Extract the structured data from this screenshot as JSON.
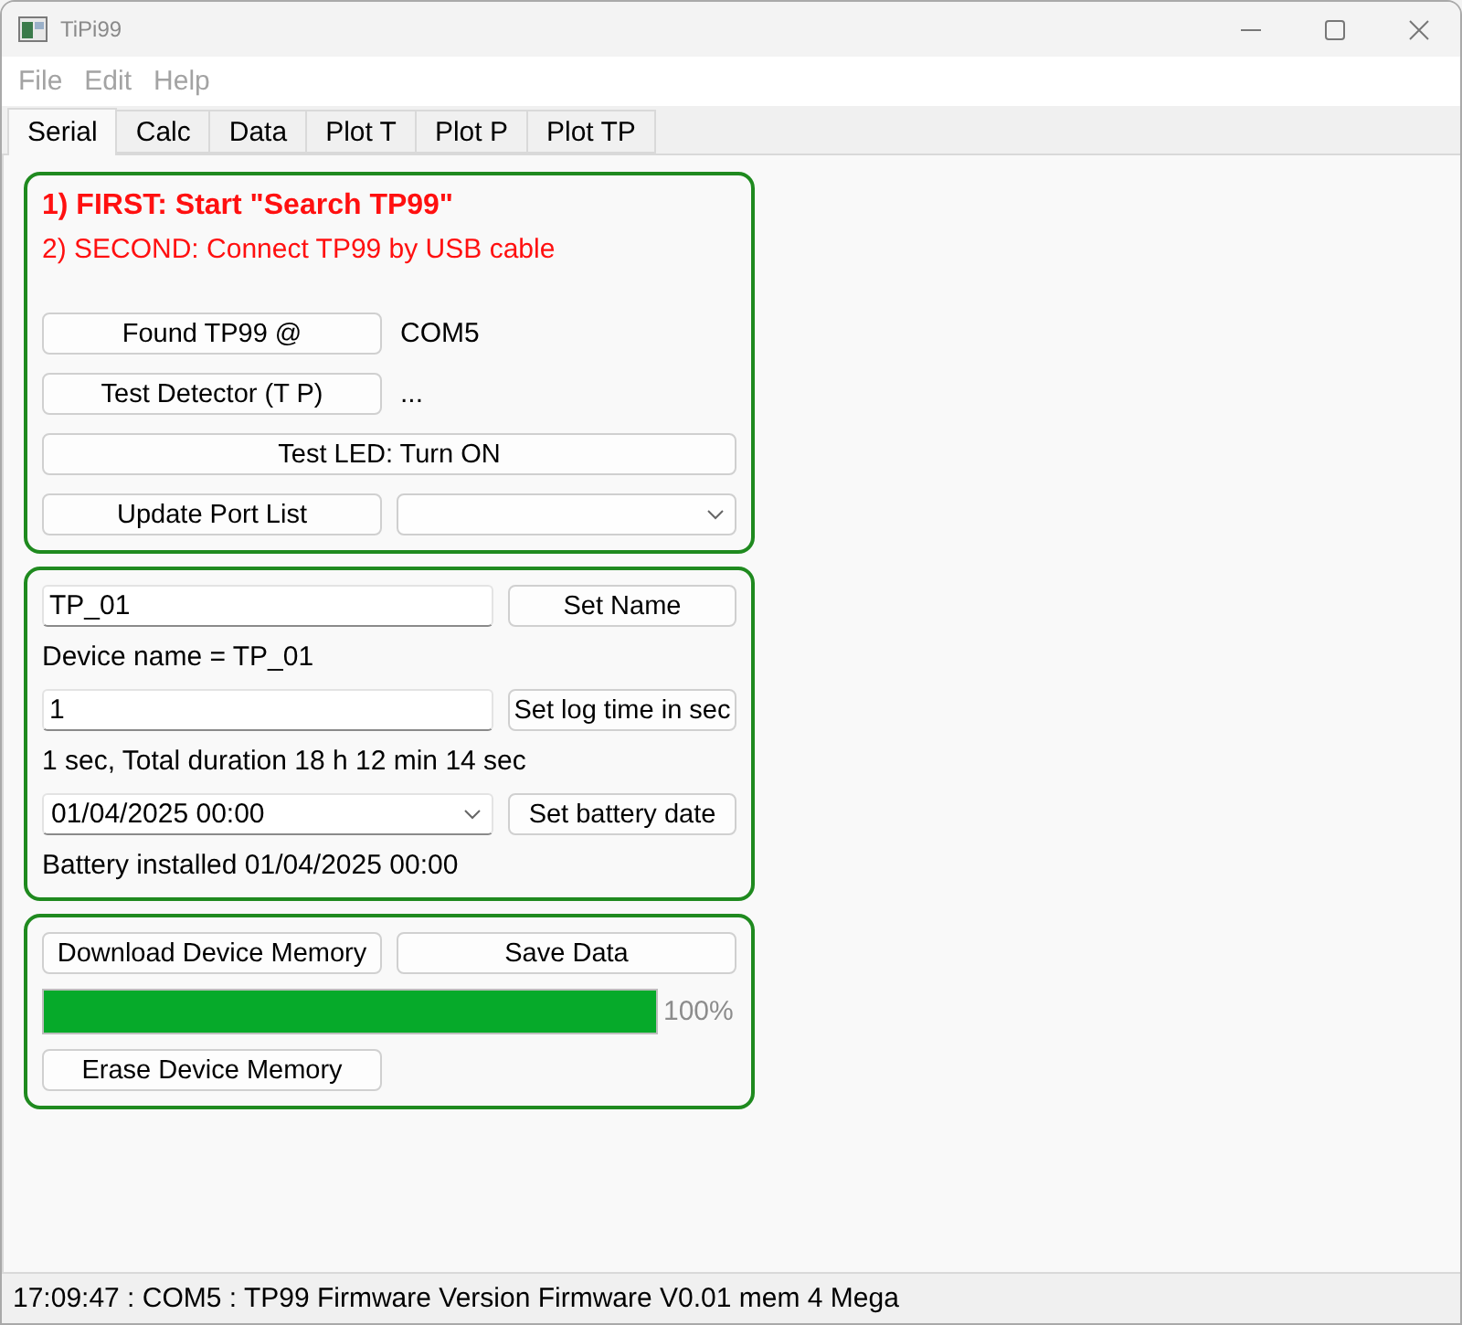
{
  "window": {
    "title": "TiPi99"
  },
  "menu": [
    {
      "label": "File"
    },
    {
      "label": "Edit"
    },
    {
      "label": "Help"
    }
  ],
  "tabs": [
    {
      "label": "Serial",
      "selected": true
    },
    {
      "label": "Calc",
      "selected": false
    },
    {
      "label": "Data",
      "selected": false
    },
    {
      "label": "Plot T",
      "selected": false
    },
    {
      "label": "Plot P",
      "selected": false
    },
    {
      "label": "Plot TP",
      "selected": false
    }
  ],
  "connection_group": {
    "instructions": [
      {
        "kind": "bold",
        "text": "1) FIRST: Start \"Search TP99\""
      },
      {
        "kind": "normal",
        "text": "2) SECOND: Connect TP99 by USB cable"
      }
    ],
    "rows": [
      {
        "kind": "button-label",
        "button": "Found TP99 @",
        "label": "COM5"
      },
      {
        "kind": "button-label",
        "button": "Test Detector (T P)",
        "label": "..."
      },
      {
        "kind": "wide-button",
        "button": "Test LED: Turn ON"
      },
      {
        "kind": "button-select",
        "button": "Update Port List"
      }
    ]
  },
  "device_group": {
    "rows": [
      {
        "kind": "input",
        "value": "TP_01",
        "button": "Set Name"
      },
      {
        "kind": "label",
        "text": "Device name = TP_01"
      },
      {
        "kind": "input",
        "value": "1",
        "button": "Set log time in sec"
      },
      {
        "kind": "label",
        "text": "1 sec, Total duration 18 h 12 min 14 sec"
      },
      {
        "kind": "date",
        "value": "01/04/2025 00:00",
        "button": "Set battery date"
      },
      {
        "kind": "label",
        "text": "Battery installed 01/04/2025 00:00"
      }
    ]
  },
  "memory_group": {
    "buttons": [
      "Download Device Memory",
      "Save Data"
    ],
    "progress": {
      "level": 1,
      "reading": "100%"
    },
    "erase_button": "Erase Device Memory"
  },
  "status_bar": {
    "text": "17:09:47 : COM5 : TP99 Firmware Version Firmware V0.01 mem 4 Mega"
  }
}
